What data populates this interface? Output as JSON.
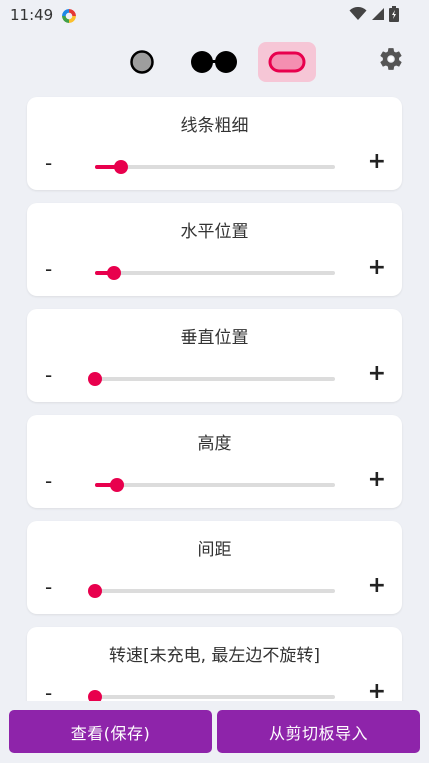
{
  "status_bar": {
    "time": "11:49"
  },
  "mode_bar": {
    "modes": [
      "circle-mode",
      "glasses-mode",
      "pill-mode"
    ],
    "selected": "pill-mode",
    "accent": "#f6c6d6"
  },
  "sliders": [
    {
      "label": "线条粗细",
      "minus": "-",
      "plus": "+",
      "value": 0.11
    },
    {
      "label": "水平位置",
      "minus": "-",
      "plus": "+",
      "value": 0.08
    },
    {
      "label": "垂直位置",
      "minus": "-",
      "plus": "+",
      "value": 0.0
    },
    {
      "label": "高度",
      "minus": "-",
      "plus": "+",
      "value": 0.09
    },
    {
      "label": "间距",
      "minus": "-",
      "plus": "+",
      "value": 0.0
    },
    {
      "label": "转速[未充电, 最左边不旋转]",
      "minus": "-",
      "plus": "+",
      "value": 0.0
    }
  ],
  "buttons": {
    "view_save": "查看(保存)",
    "import_clipboard": "从剪切板导入"
  },
  "colors": {
    "slider_active": "#e8004d",
    "button_bg": "#8e24aa"
  }
}
